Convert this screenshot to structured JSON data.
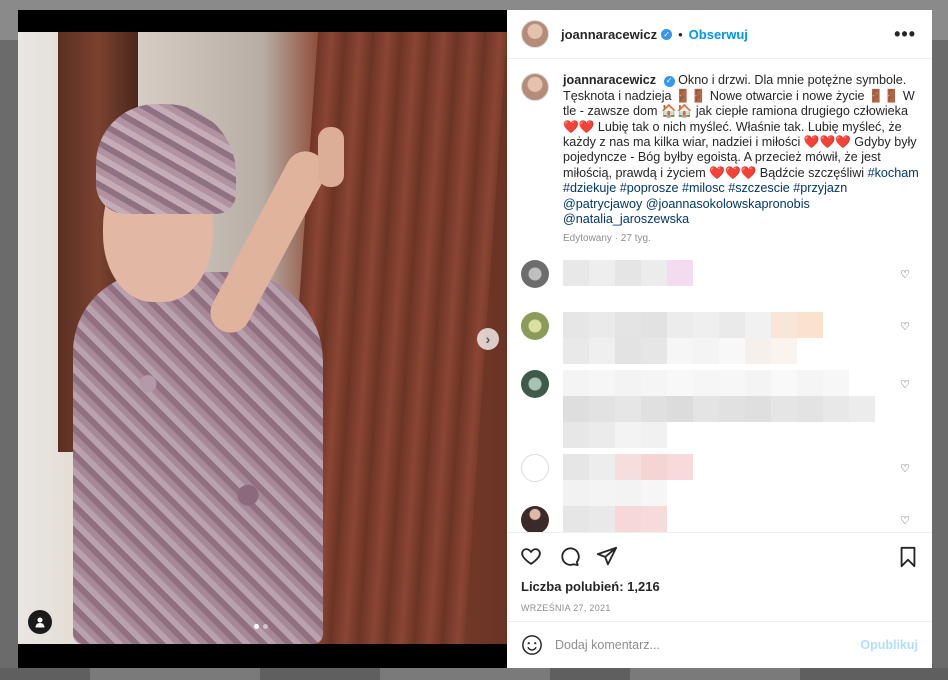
{
  "post": {
    "username": "joannaracewicz",
    "separator": "•",
    "follow_label": "Obserwuj",
    "more_label": "•••",
    "next_label": "›",
    "caption_body": "Okno i drzwi. Dla mnie potężne symbole. Tęsknota i nadzieja 🚪🚪 Nowe otwarcie i nowe życie 🚪🚪 W tle - zawsze dom 🏠🏠 jak ciepłe ramiona drugiego człowieka ❤️❤️ Lubię tak o nich myśleć. Właśnie tak. Lubię myśleć, że każdy z nas ma kilka wiar, nadziei i miłości ❤️❤️❤️ Gdyby były pojedyncze - Bóg byłby egoistą. A przecież mówił, że jest miłością, prawdą i życiem ❤️❤️❤️ Bądźcie szczęśliwi",
    "hashtags": "#kocham #dziekuje #poprosze #milosc #szczescie #przyjazn",
    "mentions": "@patrycjawoy @joannasokolowskapronobis @natalia_jaroszewska",
    "edited": "Edytowany · 27 tyg.",
    "likes": "Liczba polubień: 1,216",
    "date": "WRZEŚNIA 27, 2021",
    "comment_placeholder": "Dodaj komentarz...",
    "post_label": "Opublikuj"
  },
  "icons": {
    "verified": "verified-badge-icon",
    "heart": "heart-icon",
    "comment": "comment-icon",
    "share": "share-icon",
    "save": "bookmark-icon",
    "emoji": "emoji-icon",
    "tag": "user-tag-icon",
    "next": "chevron-right-icon"
  },
  "colors": {
    "accent": "#0095f6",
    "link": "#00376b",
    "muted": "#8e8e8e"
  },
  "carousel": {
    "total": 2,
    "active_index": 0
  }
}
